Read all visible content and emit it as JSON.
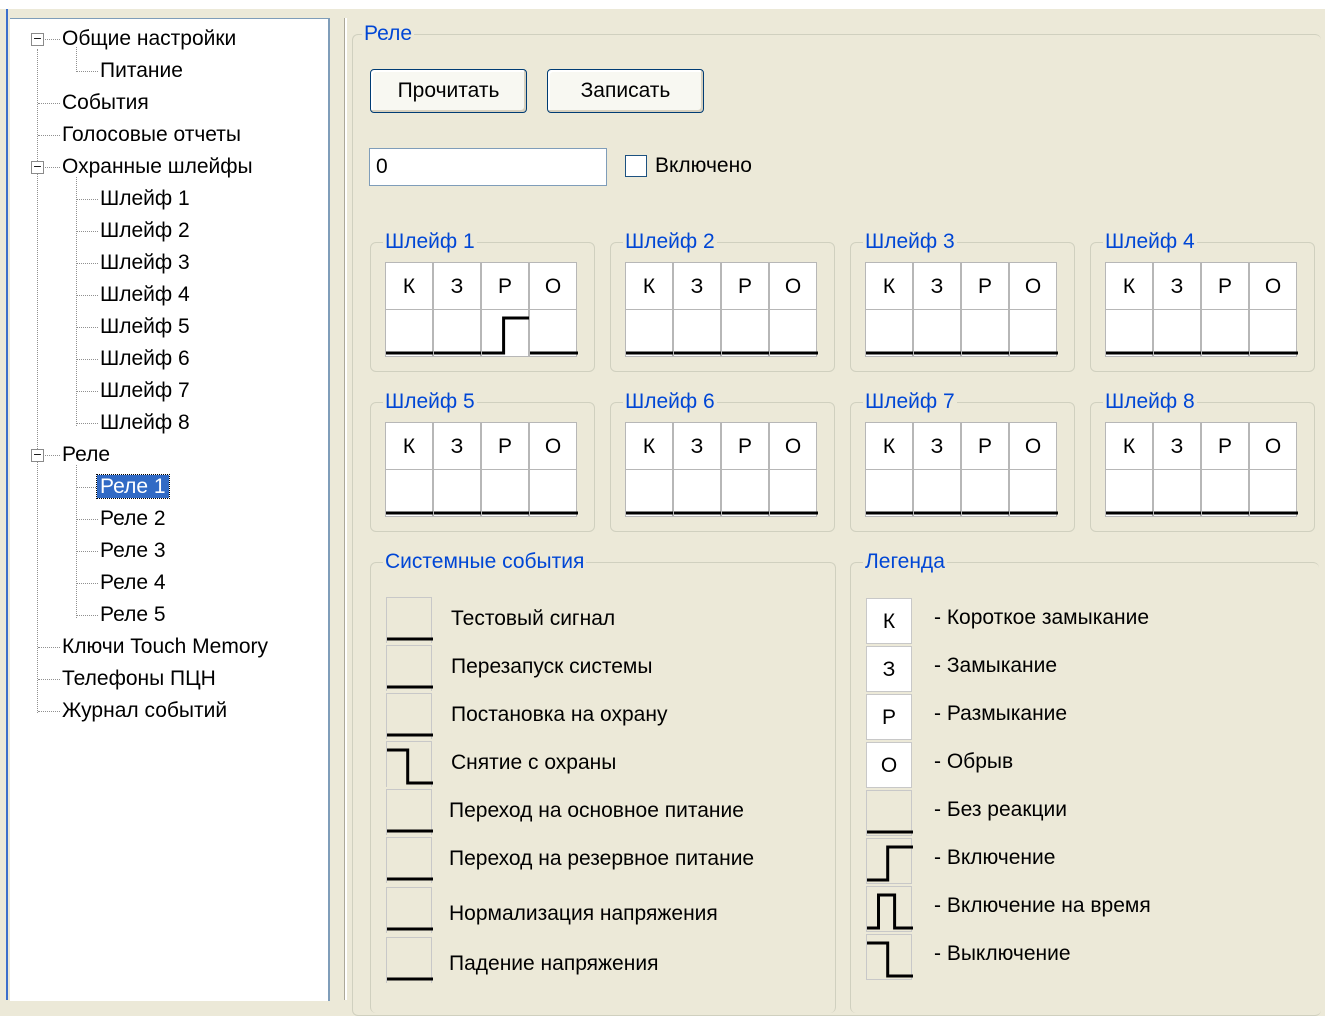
{
  "tree": {
    "nodes": [
      {
        "label": "Общие настройки",
        "expander": "−"
      },
      {
        "label": "Питание"
      },
      {
        "label": "События"
      },
      {
        "label": "Голосовые отчеты"
      },
      {
        "label": "Охранные шлейфы",
        "expander": "−"
      },
      {
        "label": "Шлейф 1"
      },
      {
        "label": "Шлейф 2"
      },
      {
        "label": "Шлейф 3"
      },
      {
        "label": "Шлейф 4"
      },
      {
        "label": "Шлейф 5"
      },
      {
        "label": "Шлейф 6"
      },
      {
        "label": "Шлейф 7"
      },
      {
        "label": "Шлейф 8"
      },
      {
        "label": "Реле",
        "expander": "−"
      },
      {
        "label": "Реле 1",
        "selected": true
      },
      {
        "label": "Реле 2"
      },
      {
        "label": "Реле 3"
      },
      {
        "label": "Реле 4"
      },
      {
        "label": "Реле 5"
      },
      {
        "label": "Ключи Touch Memory"
      },
      {
        "label": "Телефоны ПЦН"
      },
      {
        "label": "Журнал событий"
      }
    ]
  },
  "relay": {
    "group_title": "Реле",
    "read_button": "Прочитать",
    "write_button": "Записать",
    "value_input": "0",
    "enabled_label": "Включено",
    "enabled_checked": false
  },
  "loops": {
    "headers": [
      "К",
      "З",
      "Р",
      "О"
    ],
    "items": [
      {
        "title": "Шлейф 1",
        "signals": [
          "off",
          "off",
          "on",
          "off"
        ]
      },
      {
        "title": "Шлейф 2",
        "signals": [
          "off",
          "off",
          "off",
          "off"
        ]
      },
      {
        "title": "Шлейф 3",
        "signals": [
          "off",
          "off",
          "off",
          "off"
        ]
      },
      {
        "title": "Шлейф 4",
        "signals": [
          "off",
          "off",
          "off",
          "off"
        ]
      },
      {
        "title": "Шлейф 5",
        "signals": [
          "off",
          "off",
          "off",
          "off"
        ]
      },
      {
        "title": "Шлейф 6",
        "signals": [
          "off",
          "off",
          "off",
          "off"
        ]
      },
      {
        "title": "Шлейф 7",
        "signals": [
          "off",
          "off",
          "off",
          "off"
        ]
      },
      {
        "title": "Шлейф 8",
        "signals": [
          "off",
          "off",
          "off",
          "off"
        ]
      }
    ]
  },
  "system_events": {
    "title": "Системные события",
    "items": [
      {
        "label": "Тестовый сигнал",
        "signal": "off"
      },
      {
        "label": "Перезапуск системы",
        "signal": "off"
      },
      {
        "label": "Постановка на охрану",
        "signal": "off"
      },
      {
        "label": "Снятие с  охраны",
        "signal": "fall"
      },
      {
        "label": "Переход на основное питание",
        "signal": "off"
      },
      {
        "label": "Переход на резервное питание",
        "signal": "off"
      },
      {
        "label": "Нормализация напряжения",
        "signal": "off"
      },
      {
        "label": "Падение напряжения",
        "signal": "off"
      }
    ]
  },
  "legend": {
    "title": "Легенда",
    "items": [
      {
        "symbol": "К",
        "label": "- Короткое замыкание"
      },
      {
        "symbol": "З",
        "label": "- Замыкание"
      },
      {
        "symbol": "Р",
        "label": "- Размыкание"
      },
      {
        "symbol": "О",
        "label": "- Обрыв"
      },
      {
        "symbol": "",
        "signal": "off",
        "label": "- Без реакции"
      },
      {
        "symbol": "",
        "signal": "on",
        "label": "- Включение"
      },
      {
        "symbol": "",
        "signal": "pulse",
        "label": "- Включение на время"
      },
      {
        "symbol": "",
        "signal": "fall",
        "label": "- Выключение"
      }
    ]
  },
  "colors": {
    "accent": "#0046d5",
    "selection": "#316ac5",
    "background": "#ece9d8"
  }
}
